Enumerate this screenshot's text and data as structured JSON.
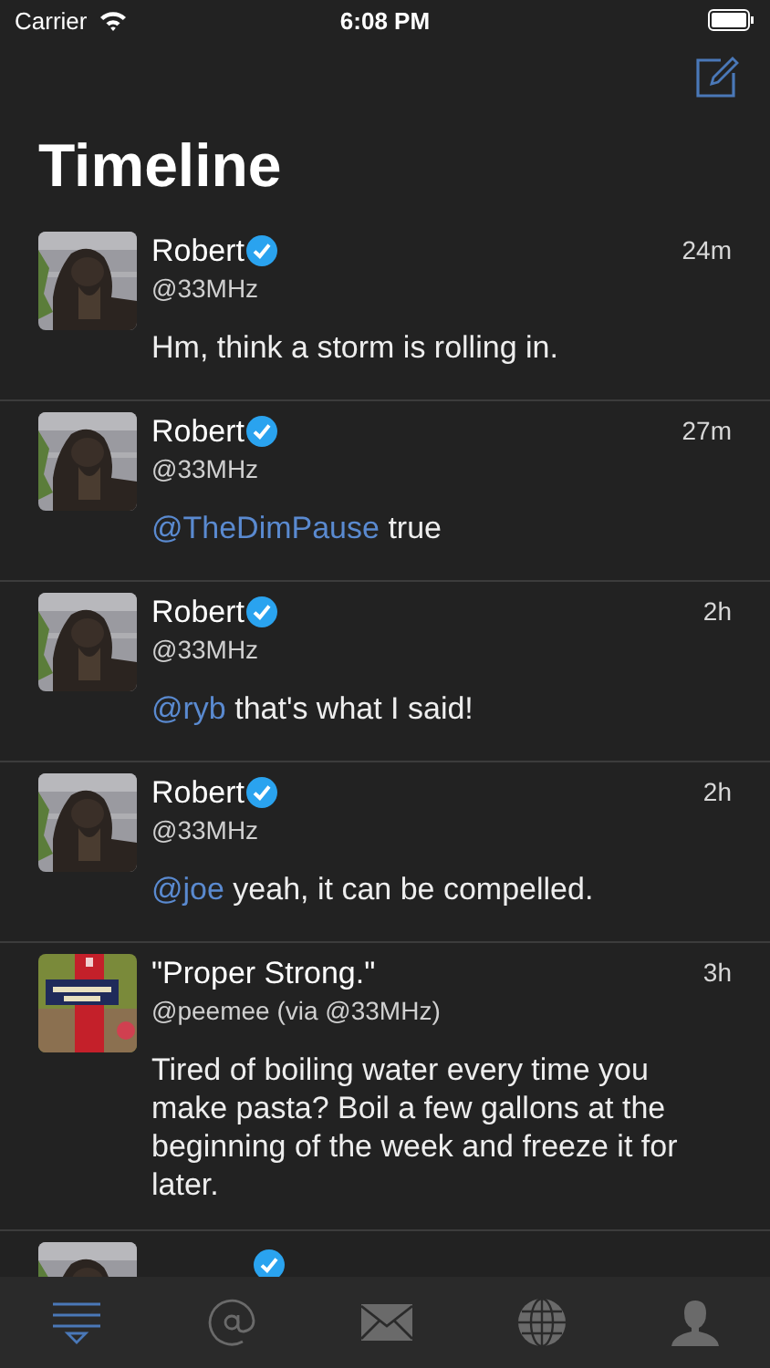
{
  "status_bar": {
    "carrier": "Carrier",
    "time": "6:08 PM"
  },
  "nav": {
    "title": "Timeline"
  },
  "posts": [
    {
      "name": "Robert",
      "verified": true,
      "handle": "@33MHz",
      "time": "24m",
      "body": [
        {
          "kind": "text",
          "text": "Hm, think a storm is rolling in."
        }
      ]
    },
    {
      "name": "Robert",
      "verified": true,
      "handle": "@33MHz",
      "time": "27m",
      "body": [
        {
          "kind": "mention",
          "text": "@TheDimPause"
        },
        {
          "kind": "text",
          "text": " true"
        }
      ]
    },
    {
      "name": "Robert",
      "verified": true,
      "handle": "@33MHz",
      "time": "2h",
      "body": [
        {
          "kind": "mention",
          "text": "@ryb"
        },
        {
          "kind": "text",
          "text": " that's what I said!"
        }
      ]
    },
    {
      "name": "Robert",
      "verified": true,
      "handle": "@33MHz",
      "time": "2h",
      "body": [
        {
          "kind": "mention",
          "text": "@joe"
        },
        {
          "kind": "text",
          "text": " yeah, it can be compelled."
        }
      ]
    },
    {
      "name": "\"Proper Strong.\"",
      "verified": false,
      "handle": "@peemee (via @33MHz)",
      "time": "3h",
      "body": [
        {
          "kind": "text",
          "text": "Tired of boiling water every time you make pasta? Boil a few gallons at the beginning of the week and freeze it for later."
        }
      ]
    },
    {
      "verified": true
    }
  ],
  "tabs": [
    {
      "kind": "timeline",
      "selected": true
    },
    {
      "kind": "mentions",
      "selected": false
    },
    {
      "kind": "messages",
      "selected": false
    },
    {
      "kind": "explore",
      "selected": false
    },
    {
      "kind": "profile",
      "selected": false
    }
  ]
}
